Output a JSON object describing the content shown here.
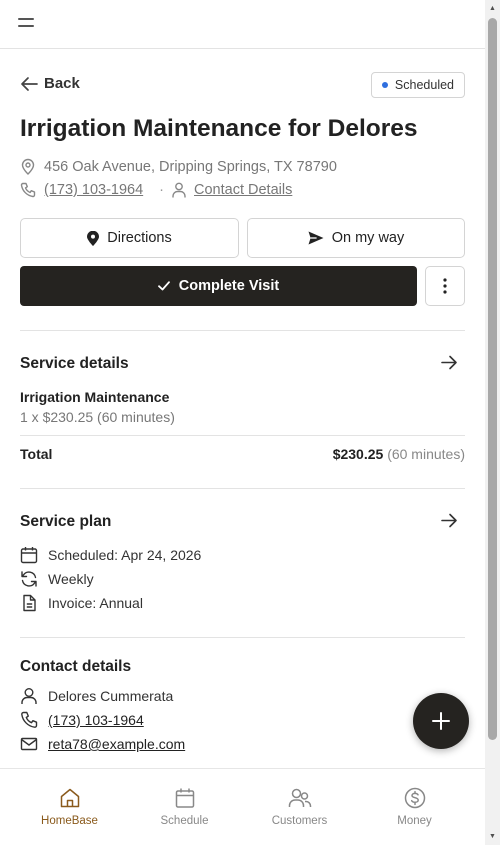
{
  "header": {
    "menu_icon": "hamburger-icon"
  },
  "nav": {
    "back_label": "Back"
  },
  "status": {
    "label": "Scheduled",
    "color": "#2f6fdf"
  },
  "visit": {
    "title": "Irrigation Maintenance for Delores",
    "address": "456 Oak Avenue, Dripping Springs, TX 78790",
    "phone": "(173) 103-1964",
    "separator": "·",
    "contact_details_link": "Contact Details"
  },
  "actions": {
    "directions_label": "Directions",
    "on_my_way_label": "On my way",
    "complete_label": "Complete Visit"
  },
  "service_details": {
    "title": "Service details",
    "item_name": "Irrigation Maintenance",
    "item_detail": "1 x $230.25 (60 minutes)",
    "total_label": "Total",
    "total_amount": "$230.25",
    "total_duration": "(60 minutes)"
  },
  "service_plan": {
    "title": "Service plan",
    "scheduled": "Scheduled: Apr 24, 2026",
    "frequency": "Weekly",
    "invoice": "Invoice: Annual"
  },
  "contact": {
    "title": "Contact details",
    "name": "Delores Cummerata",
    "phone": "(173) 103-1964",
    "email": "reta78@example.com"
  },
  "bottom_nav": {
    "items": [
      {
        "label": "HomeBase",
        "icon": "home-icon",
        "active": true
      },
      {
        "label": "Schedule",
        "icon": "calendar-icon",
        "active": false
      },
      {
        "label": "Customers",
        "icon": "users-icon",
        "active": false
      },
      {
        "label": "Money",
        "icon": "dollar-icon",
        "active": false
      }
    ]
  },
  "colors": {
    "primary_dark": "#252320",
    "active_nav": "#8a5a1c",
    "muted_text": "#777777"
  }
}
